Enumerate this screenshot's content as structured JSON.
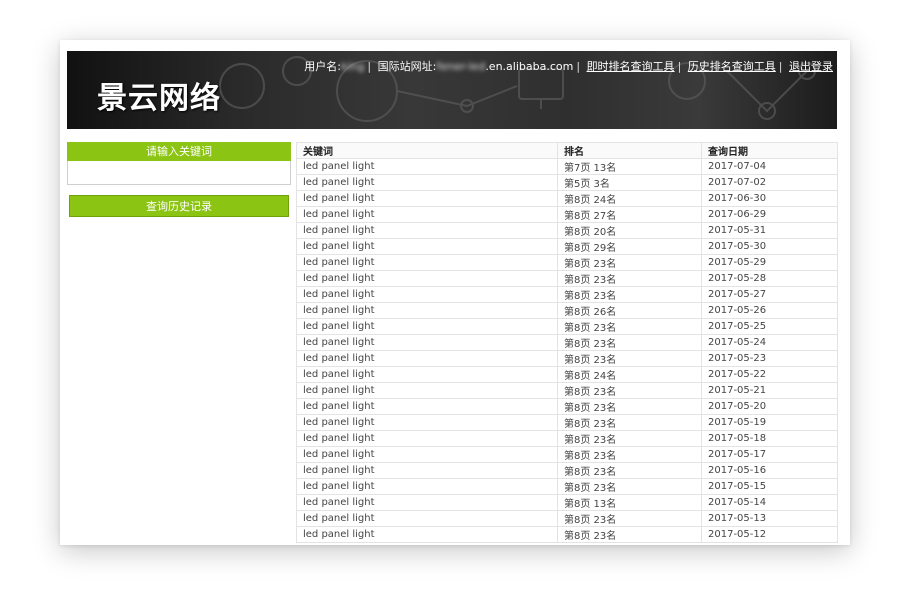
{
  "header": {
    "logo": "景云网络",
    "user_label": "用户名:",
    "user_value": "king",
    "site_label": "国际站网址:",
    "site_blur": "fener-led",
    "site_suffix": ".en.alibaba.com",
    "nav_links": [
      "即时排名查询工具",
      "历史排名查询工具",
      "退出登录"
    ],
    "colors": {
      "background": "#2a2a2a",
      "text": "#ffffff"
    }
  },
  "sidebar": {
    "keyword_label": "请输入关键词",
    "keyword_value": "",
    "history_button": "查询历史记录",
    "accent_color": "#8cc414"
  },
  "table": {
    "headers": [
      "关键词",
      "排名",
      "查询日期"
    ],
    "rows": [
      [
        "led panel light",
        "第7页 13名",
        "2017-07-04"
      ],
      [
        "led panel light",
        "第5页 3名",
        "2017-07-02"
      ],
      [
        "led panel light",
        "第8页 24名",
        "2017-06-30"
      ],
      [
        "led panel light",
        "第8页 27名",
        "2017-06-29"
      ],
      [
        "led panel light",
        "第8页 20名",
        "2017-05-31"
      ],
      [
        "led panel light",
        "第8页 29名",
        "2017-05-30"
      ],
      [
        "led panel light",
        "第8页 23名",
        "2017-05-29"
      ],
      [
        "led panel light",
        "第8页 23名",
        "2017-05-28"
      ],
      [
        "led panel light",
        "第8页 23名",
        "2017-05-27"
      ],
      [
        "led panel light",
        "第8页 26名",
        "2017-05-26"
      ],
      [
        "led panel light",
        "第8页 23名",
        "2017-05-25"
      ],
      [
        "led panel light",
        "第8页 23名",
        "2017-05-24"
      ],
      [
        "led panel light",
        "第8页 23名",
        "2017-05-23"
      ],
      [
        "led panel light",
        "第8页 24名",
        "2017-05-22"
      ],
      [
        "led panel light",
        "第8页 23名",
        "2017-05-21"
      ],
      [
        "led panel light",
        "第8页 23名",
        "2017-05-20"
      ],
      [
        "led panel light",
        "第8页 23名",
        "2017-05-19"
      ],
      [
        "led panel light",
        "第8页 23名",
        "2017-05-18"
      ],
      [
        "led panel light",
        "第8页 23名",
        "2017-05-17"
      ],
      [
        "led panel light",
        "第8页 23名",
        "2017-05-16"
      ],
      [
        "led panel light",
        "第8页 23名",
        "2017-05-15"
      ],
      [
        "led panel light",
        "第8页 13名",
        "2017-05-14"
      ],
      [
        "led panel light",
        "第8页 23名",
        "2017-05-13"
      ],
      [
        "led panel light",
        "第8页 23名",
        "2017-05-12"
      ]
    ]
  }
}
